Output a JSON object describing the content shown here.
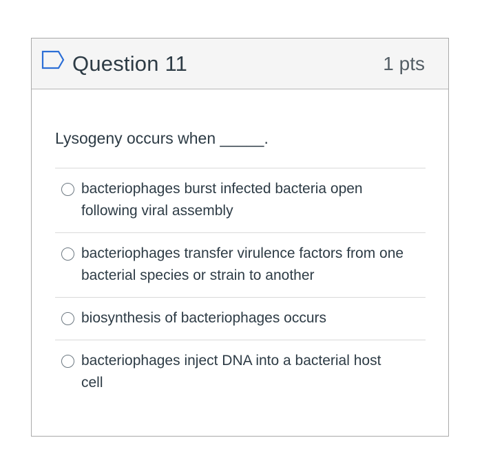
{
  "question": {
    "title": "Question 11",
    "points": "1 pts",
    "flag_icon": "bookmark-flag-icon",
    "prompt": "Lysogeny occurs when _____."
  },
  "answers": [
    {
      "label": "bacteriophages burst infected bacteria open following viral assembly"
    },
    {
      "label": "bacteriophages transfer virulence factors from one bacterial species or strain to another"
    },
    {
      "label": "biosynthesis of bacteriophages occurs"
    },
    {
      "label": "bacteriophages inject DNA into a bacterial host cell"
    }
  ],
  "colors": {
    "header_bg": "#f5f5f5",
    "border": "#a9a9a9",
    "flag": "#2b6ed6",
    "text": "#2d3b45"
  }
}
